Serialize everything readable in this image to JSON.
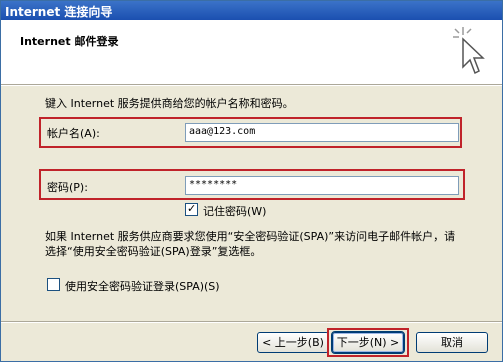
{
  "window": {
    "title": "Internet 连接向导"
  },
  "header": {
    "title": "Internet 邮件登录"
  },
  "intro": "键入 Internet 服务提供商给您的帐户名称和密码。",
  "account": {
    "label": "帐户名(A):",
    "value": "aaa@123.com"
  },
  "password": {
    "label": "密码(P):",
    "value": "********"
  },
  "remember": {
    "label": "记住密码(W)",
    "checked": true
  },
  "note": "如果 Internet 服务供应商要求您使用“安全密码验证(SPA)”来访问电子邮件帐户，请选择“使用安全密码验证(SPA)登录”复选框。",
  "spa": {
    "label": "使用安全密码验证登录(SPA)(S)",
    "checked": false
  },
  "buttons": {
    "back": "< 上一步(B)",
    "next": "下一步(N) >",
    "cancel": "取消"
  },
  "icons": {
    "wizard": "cursor-sparkle-icon"
  },
  "colors": {
    "highlight": "#c0232a",
    "title_bar": "#1b4fb0"
  }
}
